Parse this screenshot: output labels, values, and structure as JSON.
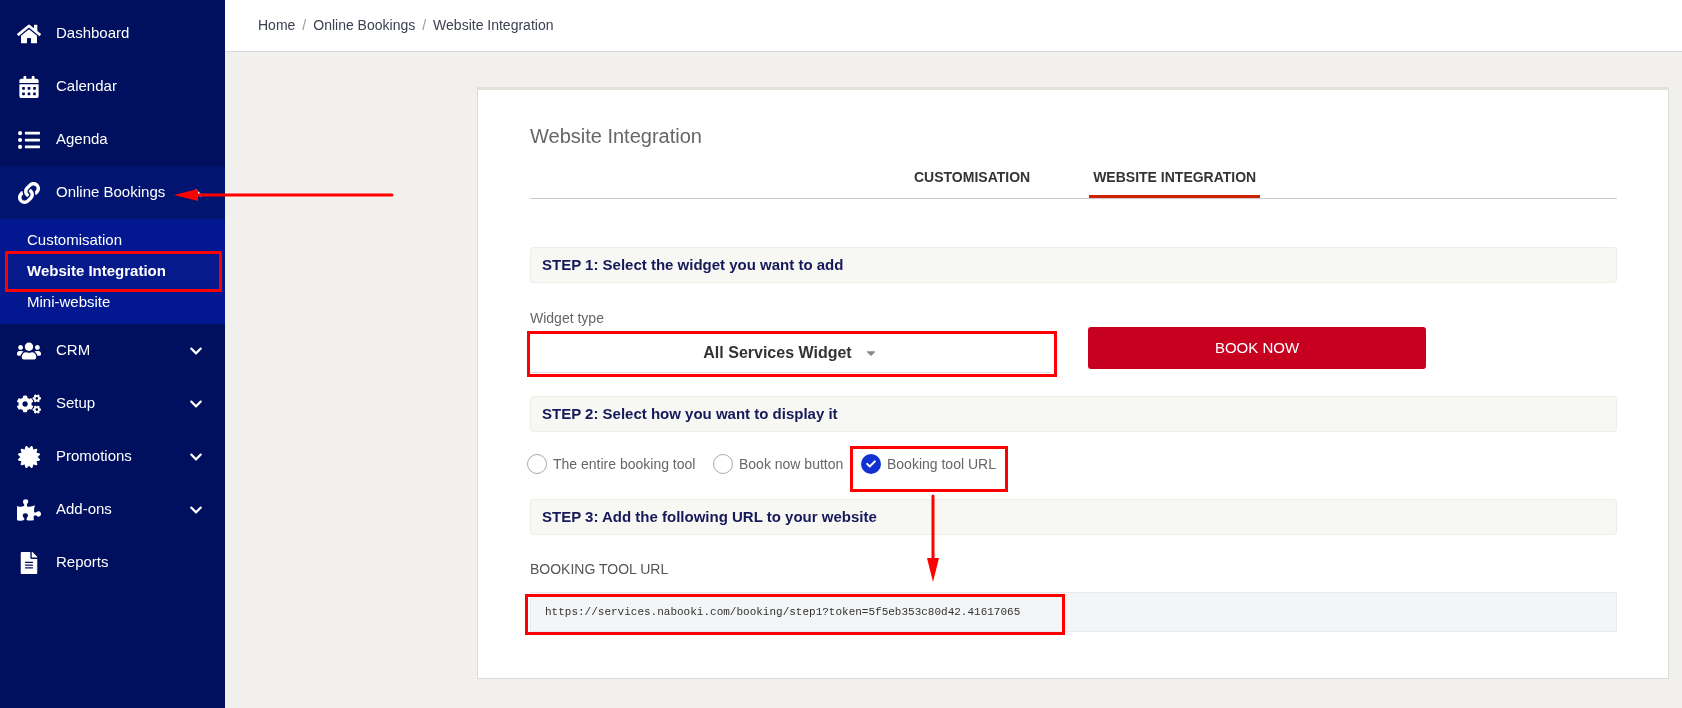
{
  "sidebar": {
    "items": [
      {
        "label": "Dashboard",
        "selected": false
      },
      {
        "label": "Calendar",
        "selected": false
      },
      {
        "label": "Agenda",
        "selected": false
      },
      {
        "label": "Online Bookings",
        "selected": true,
        "expanded": true,
        "children": [
          {
            "label": "Customisation",
            "selected": false
          },
          {
            "label": "Website Integration",
            "selected": true
          },
          {
            "label": "Mini-website",
            "selected": false
          }
        ]
      },
      {
        "label": "CRM",
        "selected": false,
        "expanded": false
      },
      {
        "label": "Setup",
        "selected": false,
        "expanded": false
      },
      {
        "label": "Promotions",
        "selected": false,
        "expanded": false
      },
      {
        "label": "Add-ons",
        "selected": false,
        "expanded": false
      },
      {
        "label": "Reports",
        "selected": false
      }
    ]
  },
  "breadcrumb": {
    "separator": "/",
    "items": [
      "Home",
      "Online Bookings",
      "Website Integration"
    ]
  },
  "card": {
    "title": "Website Integration",
    "tabs": [
      {
        "label": "CUSTOMISATION",
        "selected": false
      },
      {
        "label": "WEBSITE INTEGRATION",
        "selected": true
      }
    ],
    "step1": {
      "heading": "STEP 1: Select the widget you want to add",
      "field_label": "Widget type",
      "select_value": "All Services Widget",
      "button": "BOOK NOW"
    },
    "step2": {
      "heading": "STEP 2: Select how you want to display it",
      "options": [
        {
          "label": "The entire booking tool",
          "selected": false
        },
        {
          "label": "Book now button",
          "selected": false
        },
        {
          "label": "Booking tool URL",
          "selected": true
        }
      ]
    },
    "step3": {
      "heading": "STEP 3: Add the following URL to your website",
      "field_label": "BOOKING TOOL URL",
      "url": "https://services.nabooki.com/booking/step1?token=5f5eb353c80d42.41617065"
    }
  }
}
